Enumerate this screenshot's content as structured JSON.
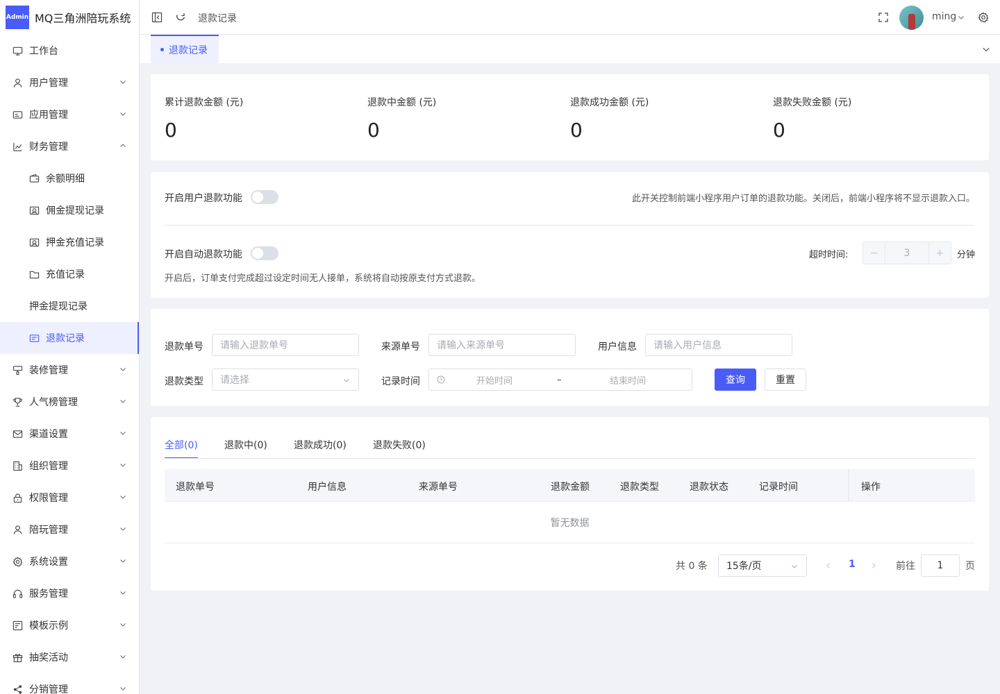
{
  "app": {
    "logo_badge": "Admin",
    "title": "MQ三角洲陪玩系统"
  },
  "sidebar": {
    "items": [
      {
        "label": "工作台",
        "icon": "monitor-icon"
      },
      {
        "label": "用户管理",
        "icon": "user-icon"
      },
      {
        "label": "应用管理",
        "icon": "app-icon"
      },
      {
        "label": "财务管理",
        "icon": "chart-icon"
      },
      {
        "label": "余额明细",
        "icon": "wallet-icon"
      },
      {
        "label": "佣金提现记录",
        "icon": "camera-icon"
      },
      {
        "label": "押金充值记录",
        "icon": "camera-icon"
      },
      {
        "label": "充值记录",
        "icon": "folder-icon"
      },
      {
        "label": "押金提现记录",
        "icon": ""
      },
      {
        "label": "退款记录",
        "icon": "list-icon"
      },
      {
        "label": "装修管理",
        "icon": "paint-icon"
      },
      {
        "label": "人气榜管理",
        "icon": "trophy-icon"
      },
      {
        "label": "渠道设置",
        "icon": "mail-icon"
      },
      {
        "label": "组织管理",
        "icon": "building-icon"
      },
      {
        "label": "权限管理",
        "icon": "lock-icon"
      },
      {
        "label": "陪玩管理",
        "icon": "user-icon"
      },
      {
        "label": "系统设置",
        "icon": "gear-icon"
      },
      {
        "label": "服务管理",
        "icon": "headset-icon"
      },
      {
        "label": "模板示例",
        "icon": "template-icon"
      },
      {
        "label": "抽奖活动",
        "icon": "gift-icon"
      },
      {
        "label": "分销管理",
        "icon": "share-icon"
      }
    ]
  },
  "header": {
    "breadcrumb": "退款记录",
    "username": "ming"
  },
  "tabs": {
    "active": "退款记录"
  },
  "stats": [
    {
      "label": "累计退款金额 (元)",
      "value": "0"
    },
    {
      "label": "退款中金额 (元)",
      "value": "0"
    },
    {
      "label": "退款成功金额 (元)",
      "value": "0"
    },
    {
      "label": "退款失败金额 (元)",
      "value": "0"
    }
  ],
  "settings": {
    "user_refund_label": "开启用户退款功能",
    "user_refund_on": false,
    "user_refund_hint": "此开关控制前端小程序用户订单的退款功能。关闭后，前端小程序将不显示退款入口。",
    "auto_refund_label": "开启自动退款功能",
    "auto_refund_on": false,
    "timeout_label": "超时时间:",
    "timeout_value": "3",
    "minus": "−",
    "plus": "+",
    "timeout_unit": "分钟",
    "auto_refund_hint": "开启后，订单支付完成超过设定时间无人接单，系统将自动按原支付方式退款。"
  },
  "filters": {
    "refund_no_label": "退款单号",
    "refund_no_placeholder": "请输入退款单号",
    "source_no_label": "来源单号",
    "source_no_placeholder": "请输入来源单号",
    "user_label": "用户信息",
    "user_placeholder": "请输入用户信息",
    "type_label": "退款类型",
    "type_placeholder": "请选择",
    "time_label": "记录时间",
    "start_placeholder": "开始时间",
    "range_sep": "–",
    "end_placeholder": "结束时间",
    "search_btn": "查询",
    "reset_btn": "重置"
  },
  "list_tabs": [
    "全部(0)",
    "退款中(0)",
    "退款成功(0)",
    "退款失败(0)"
  ],
  "table": {
    "columns": [
      "退款单号",
      "用户信息",
      "来源单号",
      "退款金额",
      "退款类型",
      "退款状态",
      "记录时间",
      "操作"
    ],
    "empty": "暂无数据"
  },
  "pagination": {
    "total": "共 0 条",
    "page_size": "15条/页",
    "current": "1",
    "goto_label": "前往",
    "goto_value": "1",
    "page_suffix": "页"
  },
  "colors": {
    "accent": "#4a5cf7",
    "bg": "#f0f2f5"
  }
}
